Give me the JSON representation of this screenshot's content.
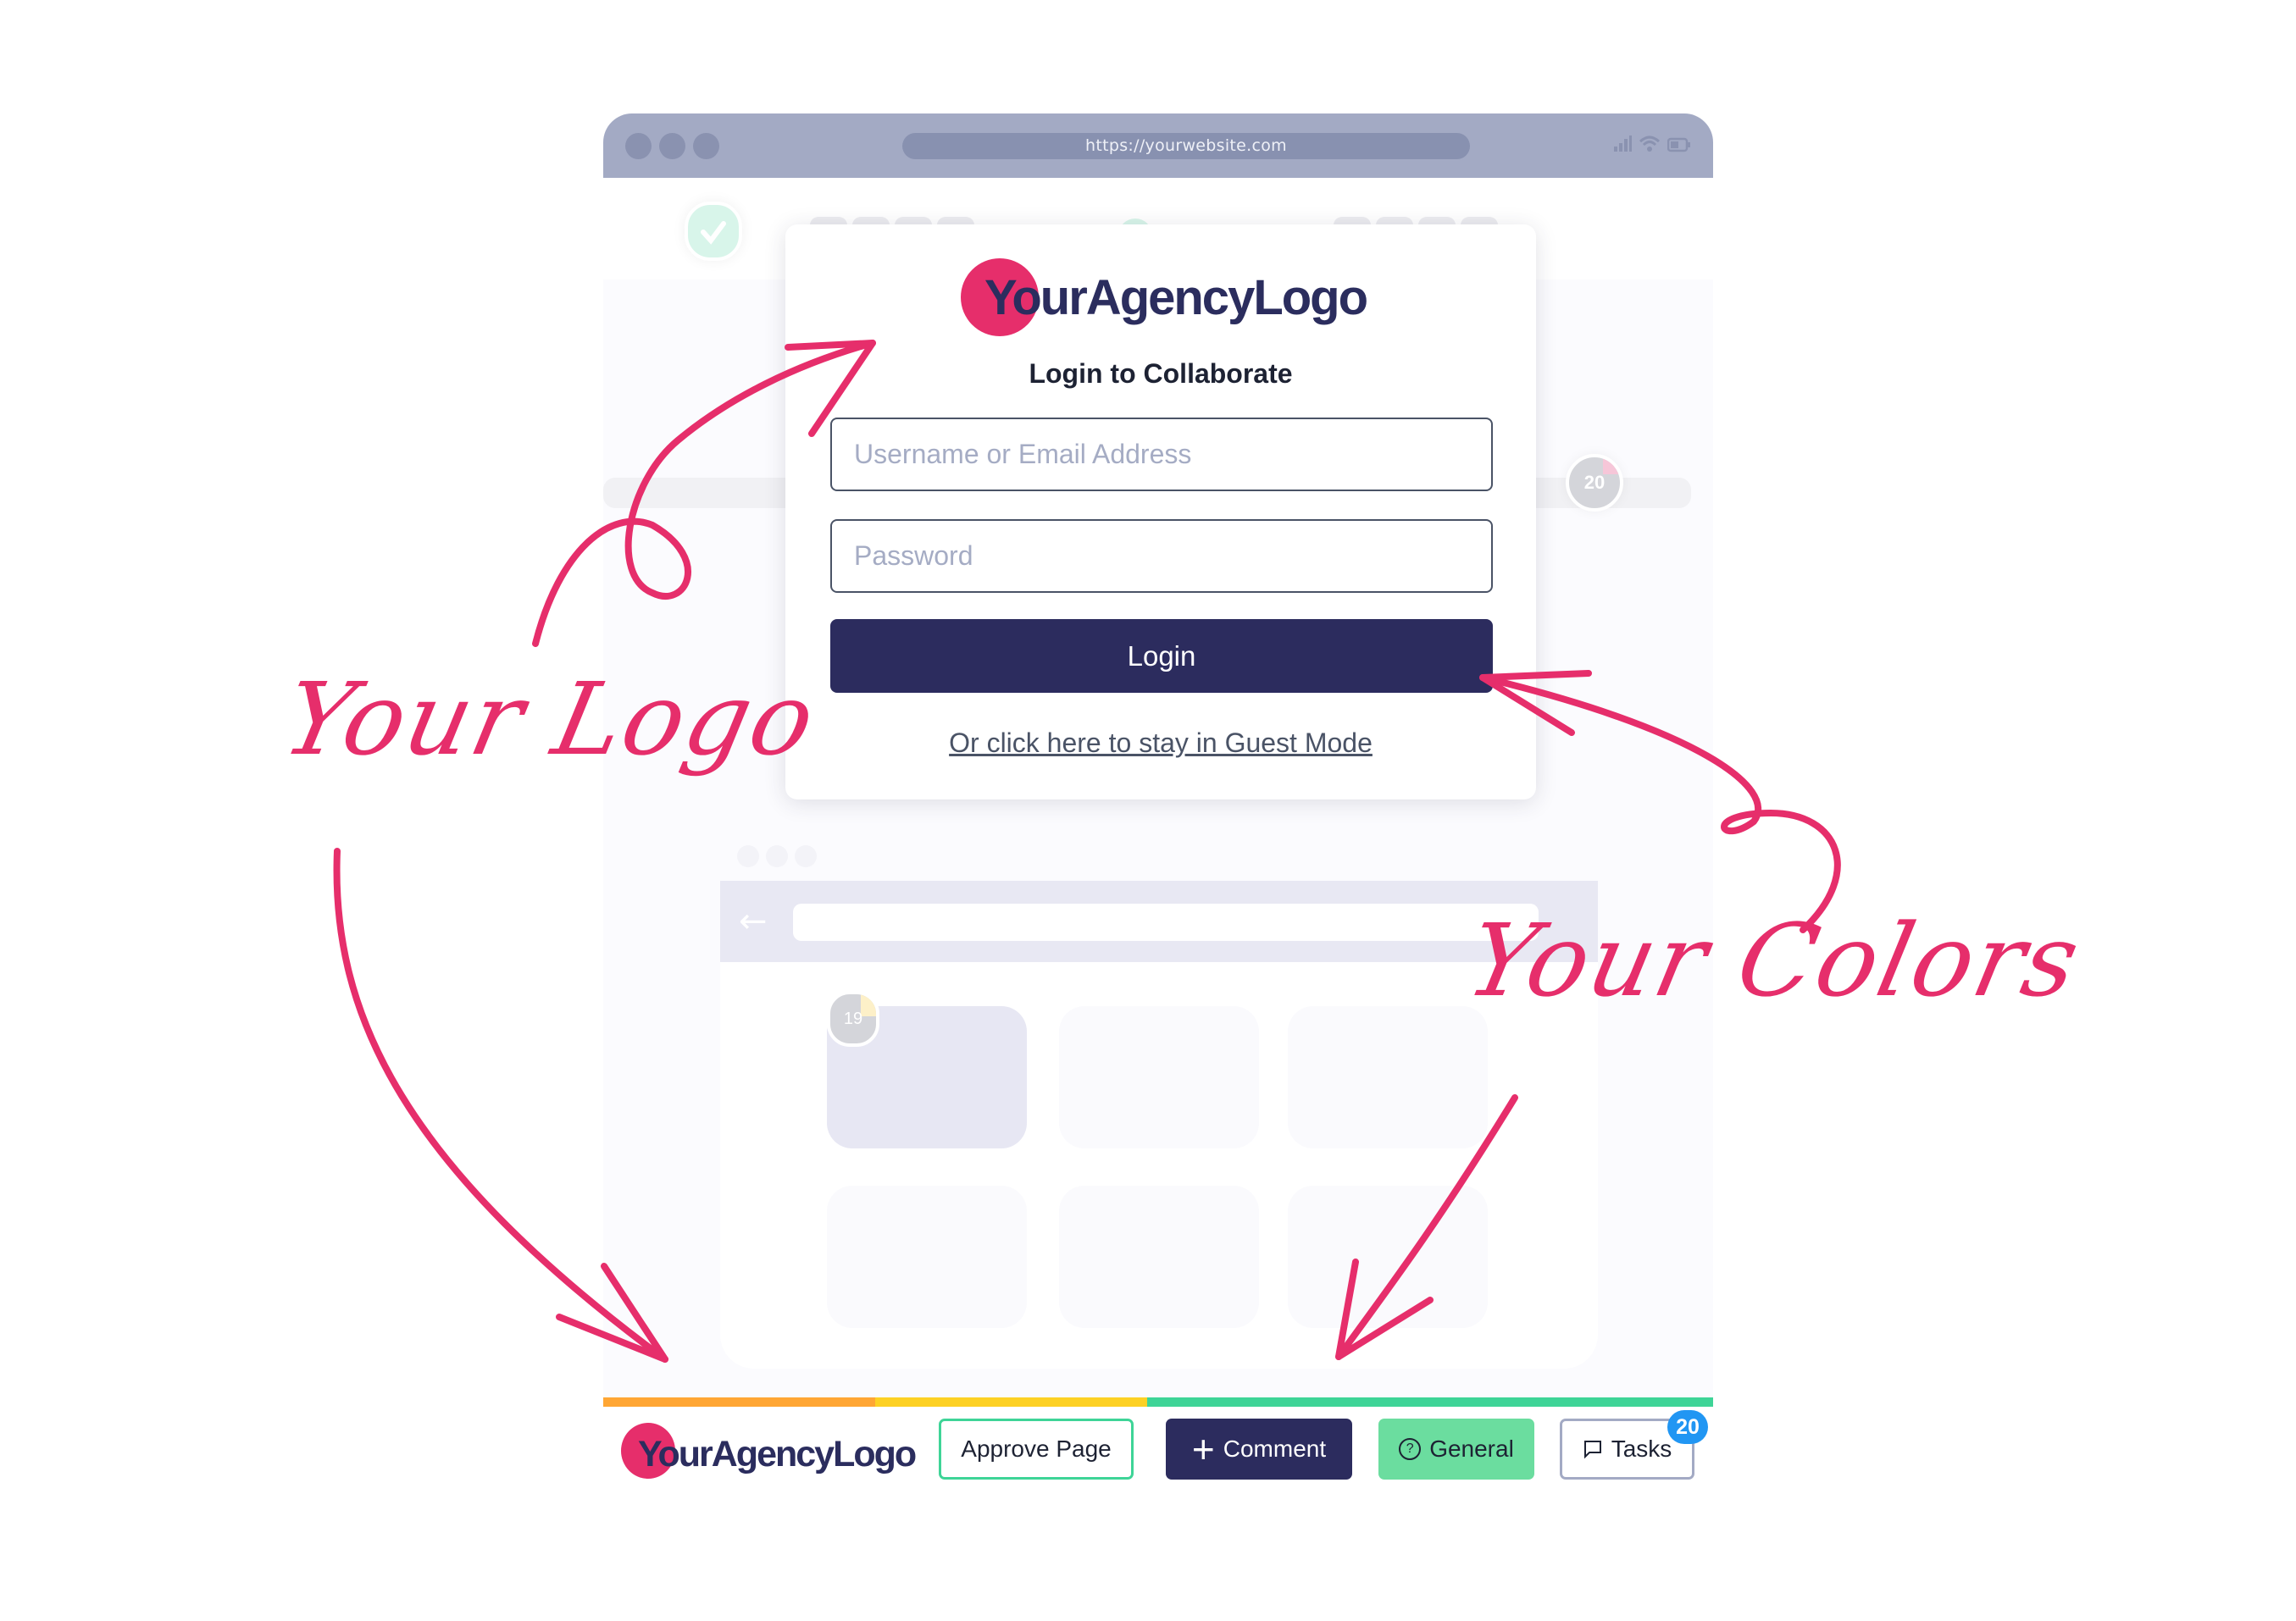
{
  "browser": {
    "url": "https://yourwebsite.com",
    "window_dots": [
      "close",
      "minimize",
      "maximize"
    ],
    "status_icons": [
      "signal-icon",
      "wifi-icon",
      "battery-icon"
    ]
  },
  "background_page": {
    "pin_badges": [
      "20",
      "19"
    ],
    "inner_browser": {
      "back_icon": "←"
    }
  },
  "login_card": {
    "logo": {
      "text": "YourAgencyLogo",
      "brand_color": "#e62e6b",
      "text_color": "#2b2d5e"
    },
    "title": "Login to Collaborate",
    "username": {
      "value": "",
      "placeholder": "Username or Email Address"
    },
    "password": {
      "value": "",
      "placeholder": "Password"
    },
    "login_label": "Login",
    "guest_link": "Or click here to stay in Guest Mode",
    "primary_color": "#2c2c5e"
  },
  "color_bar": [
    {
      "color": "#ffa634",
      "share": 0.245
    },
    {
      "color": "#fdd124",
      "share": 0.245
    },
    {
      "color": "#3ed497",
      "share": 0.51
    }
  ],
  "toolbar": {
    "logo_text": "YourAgencyLogo",
    "approve_label": "Approve Page",
    "comment_icon": "+",
    "comment_label": "Comment",
    "general_icon": "?",
    "general_label": "General",
    "tasks_icon": "💬",
    "tasks_label": "Tasks",
    "tasks_count": "20"
  },
  "annotations": {
    "logo_label": "Your Logo",
    "colors_label": "Your Colors",
    "color": "#e62e6b"
  }
}
